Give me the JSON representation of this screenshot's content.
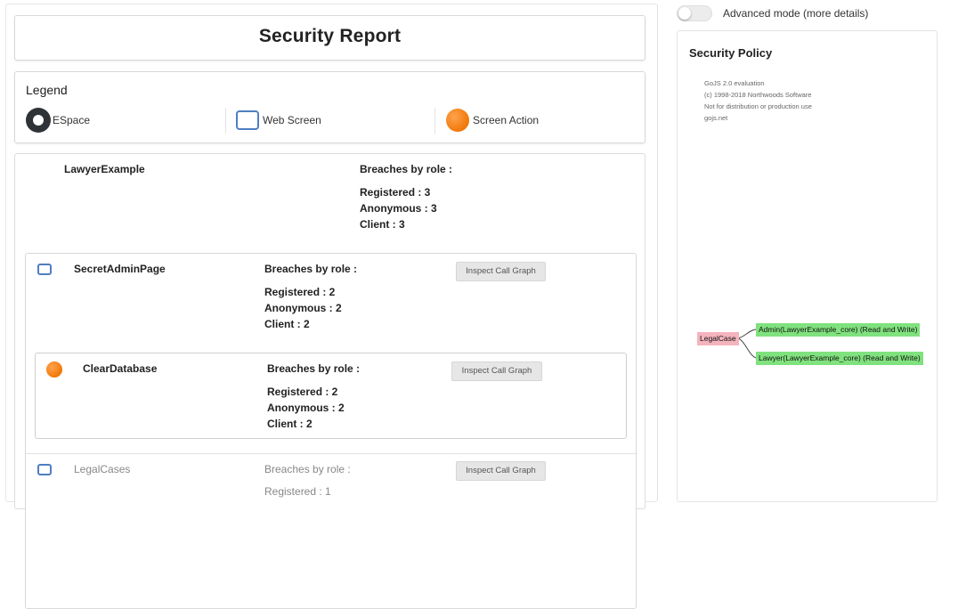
{
  "header": {
    "title": "Security Report"
  },
  "legend": {
    "title": "Legend",
    "items": [
      {
        "label": "ESpace",
        "icon": "espace-icon"
      },
      {
        "label": "Web Screen",
        "icon": "web-screen-icon"
      },
      {
        "label": "Screen Action",
        "icon": "screen-action-icon"
      }
    ]
  },
  "root": {
    "name": "LawyerExample",
    "breaches_title": "Breaches by role :",
    "breaches": [
      "Registered : 3",
      "Anonymous : 3",
      "Client : 3"
    ]
  },
  "screens": [
    {
      "name": "SecretAdminPage",
      "breaches_title": "Breaches by role :",
      "breaches": [
        "Registered : 2",
        "Anonymous : 2",
        "Client : 2"
      ],
      "button": "Inspect Call Graph",
      "actions": [
        {
          "name": "ClearDatabase",
          "breaches_title": "Breaches by role :",
          "breaches": [
            "Registered : 2",
            "Anonymous : 2",
            "Client : 2"
          ],
          "button": "Inspect Call Graph"
        }
      ]
    },
    {
      "name": "LegalCases",
      "breaches_title": "Breaches by role :",
      "breaches": [
        "Registered : 1"
      ],
      "button": "Inspect Call Graph"
    }
  ],
  "advanced_mode": {
    "label": "Advanced mode (more details)",
    "enabled": false
  },
  "policy": {
    "title": "Security Policy",
    "watermark": [
      "GoJS 2.0 evaluation",
      "(c) 1998-2018 Northwoods Software",
      "Not for distribution or production use",
      "gojs.net"
    ],
    "diagram": {
      "source": "LegalCase",
      "targets": [
        "Admin(LawyerExample_core) (Read and Write)",
        "Lawyer(LawyerExample_core) (Read and Write)"
      ]
    }
  },
  "colors": {
    "espace": "#2f3337",
    "screen": "#4e7fc2",
    "action": "#f07808",
    "source_node": "#f4b4be",
    "target_node": "#80e27e"
  }
}
